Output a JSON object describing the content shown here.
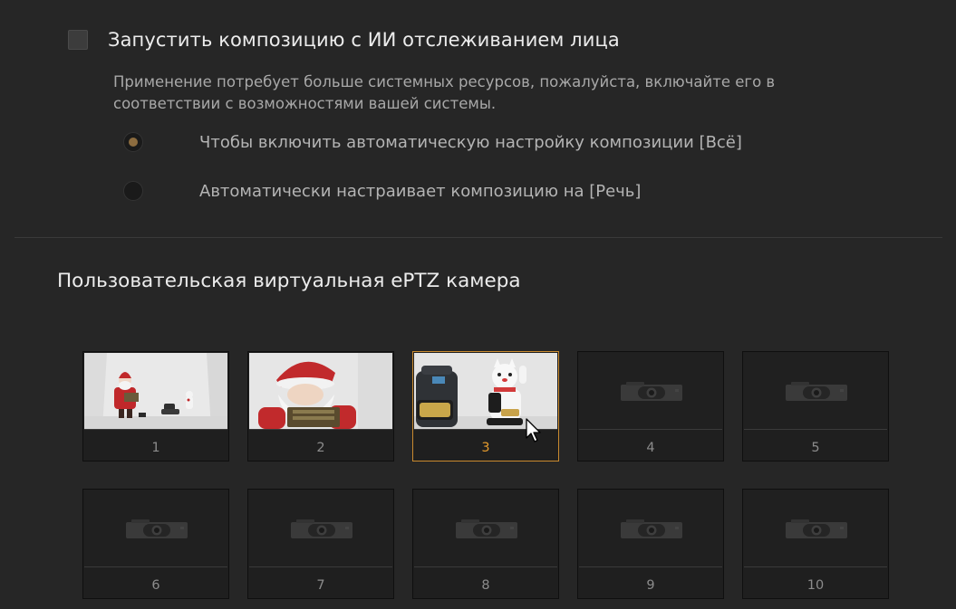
{
  "face_tracking": {
    "checkbox_label": "Запустить композицию с ИИ отслеживанием лица",
    "checked": false,
    "description": "Применение потребует больше системных ресурсов, пожалуйста, включайте его в соответствии с возможностями вашей системы.",
    "options": [
      {
        "label": "Чтобы включить автоматическую настройку композиции [Всё]",
        "selected": true
      },
      {
        "label": "Автоматически настраивает композицию на [Речь]",
        "selected": false
      }
    ]
  },
  "eptz": {
    "title": "Пользовательская виртуальная ePTZ камера",
    "selected": 3,
    "presets": [
      {
        "label": "1",
        "thumbnail": "santa-wide"
      },
      {
        "label": "2",
        "thumbnail": "santa-closeup"
      },
      {
        "label": "3",
        "thumbnail": "lucky-cat-scene"
      },
      {
        "label": "4",
        "thumbnail": "empty-camera-icon"
      },
      {
        "label": "5",
        "thumbnail": "empty-camera-icon"
      },
      {
        "label": "6",
        "thumbnail": "empty-camera-icon"
      },
      {
        "label": "7",
        "thumbnail": "empty-camera-icon"
      },
      {
        "label": "8",
        "thumbnail": "empty-camera-icon"
      },
      {
        "label": "9",
        "thumbnail": "empty-camera-icon"
      },
      {
        "label": "10",
        "thumbnail": "empty-camera-icon"
      }
    ]
  },
  "colors": {
    "background": "#262626",
    "accent": "#e39a2d",
    "selected_border": "#c98a2e",
    "radio_dot": "#8c6c3f"
  }
}
